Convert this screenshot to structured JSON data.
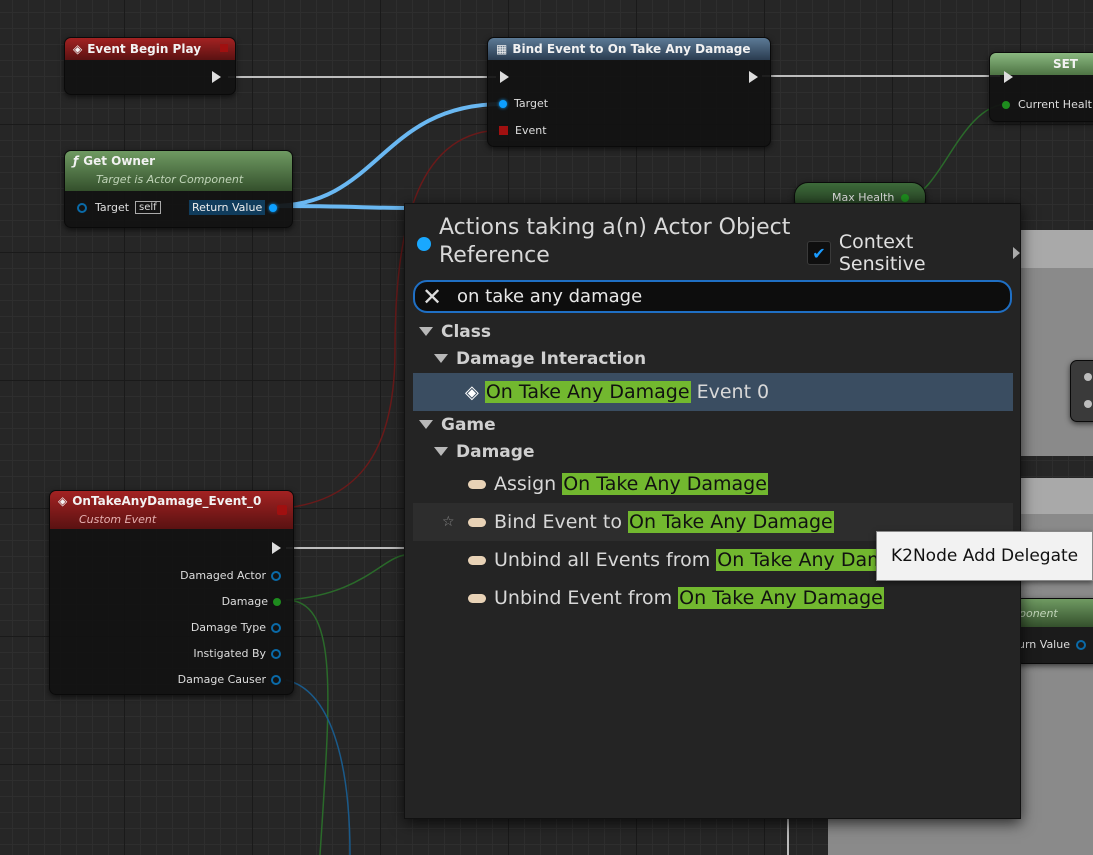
{
  "nodes": {
    "event_begin_play": {
      "title": "Event Begin Play"
    },
    "bind_event": {
      "title": "Bind Event to On Take Any Damage",
      "pin_target": "Target",
      "pin_event": "Event"
    },
    "set_node": {
      "title": "SET",
      "pin_current_health": "Current Healt"
    },
    "get_owner": {
      "title": "Get Owner",
      "subtitle": "Target is Actor Component",
      "pin_target": "Target",
      "self_label": "self",
      "pin_return": "Return Value"
    },
    "max_health": {
      "label": "Max Health"
    },
    "custom_event": {
      "title": "OnTakeAnyDamage_Event_0",
      "subtitle": "Custom Event",
      "pins": [
        "Damaged Actor",
        "Damage",
        "Damage Type",
        "Instigated By",
        "Damage Causer"
      ]
    },
    "partial_right": {
      "subtitle": "ponent",
      "pin_return": "urn Value"
    }
  },
  "menu": {
    "title": "Actions taking a(n) Actor Object Reference",
    "context_sensitive_label": "Context Sensitive",
    "context_sensitive_checked": true,
    "search_value": "on take any damage",
    "categories": {
      "class": "Class",
      "damage_interaction": "Damage Interaction",
      "game": "Game",
      "damage": "Damage"
    },
    "items": {
      "on_take_event": {
        "highlight": "On Take Any Damage",
        "rest": " Event 0"
      },
      "assign": {
        "prefix": "Assign ",
        "highlight": "On Take Any Damage"
      },
      "bind": {
        "prefix": "Bind Event to ",
        "highlight": "On Take Any Damage"
      },
      "unbind_all": {
        "prefix": "Unbind all Events from ",
        "highlight": "On Take Any Damag"
      },
      "unbind": {
        "prefix": "Unbind Event from ",
        "highlight": "On Take Any Damage"
      }
    }
  },
  "tooltip": {
    "text": "K2Node Add Delegate"
  },
  "colors": {
    "highlight": "#72b82f",
    "selected_row": "#3a4d61",
    "object_pin": "#0d9fff",
    "float_pin": "#1e8c1e",
    "delegate_pin": "#a01010"
  }
}
